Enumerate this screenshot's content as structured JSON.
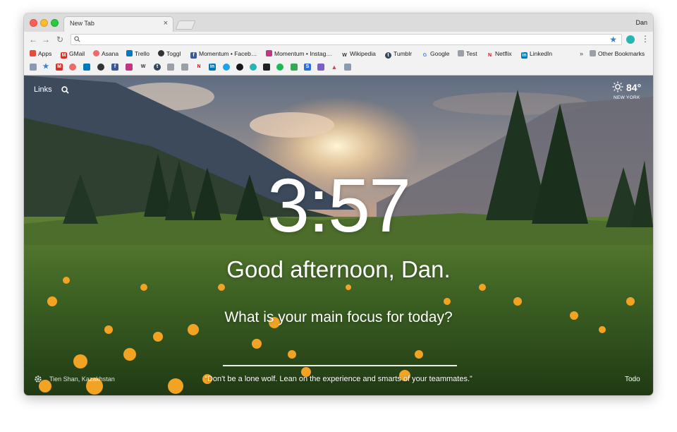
{
  "browser": {
    "tab_title": "New Tab",
    "tab_close": "×",
    "profile_name": "Dan",
    "address_value": "",
    "bookmarks": [
      {
        "label": "Apps",
        "icon": "apps-grid-icon",
        "color": "#e44d3a"
      },
      {
        "label": "GMail",
        "icon": "gmail-icon",
        "color": "#d93025"
      },
      {
        "label": "Asana",
        "icon": "asana-icon",
        "color": "#f06a6a"
      },
      {
        "label": "Trello",
        "icon": "trello-icon",
        "color": "#0079bf"
      },
      {
        "label": "Toggl",
        "icon": "toggl-icon",
        "color": "#333333"
      },
      {
        "label": "Momentum • Faceb…",
        "icon": "facebook-icon",
        "color": "#3b5998"
      },
      {
        "label": "Momentum • Instag…",
        "icon": "instagram-icon",
        "color": "#c13584"
      },
      {
        "label": "Wikipedia",
        "icon": "wikipedia-icon",
        "color": "#444444"
      },
      {
        "label": "Tumblr",
        "icon": "tumblr-icon",
        "color": "#35465c"
      },
      {
        "label": "Google",
        "icon": "google-icon",
        "color": "#4285f4"
      },
      {
        "label": "Test",
        "icon": "folder-icon",
        "color": "#9aa0a6"
      },
      {
        "label": "Netflix",
        "icon": "netflix-icon",
        "color": "#e50914"
      },
      {
        "label": "LinkedIn",
        "icon": "linkedin-icon",
        "color": "#0077b5"
      }
    ],
    "more_chevron": "»",
    "other_bookmarks": "Other Bookmarks"
  },
  "momentum": {
    "links_label": "Links",
    "temperature": "84°",
    "location": "NEW YORK",
    "time": "3:57",
    "greeting": "Good afternoon, Dan.",
    "focus_question": "What is your main focus for today?",
    "photo_location": "Tien Shan, Kazakhstan",
    "quote": "“Don't be a lone wolf. Lean on the experience and smarts of your teammates.”",
    "todo_label": "Todo"
  }
}
